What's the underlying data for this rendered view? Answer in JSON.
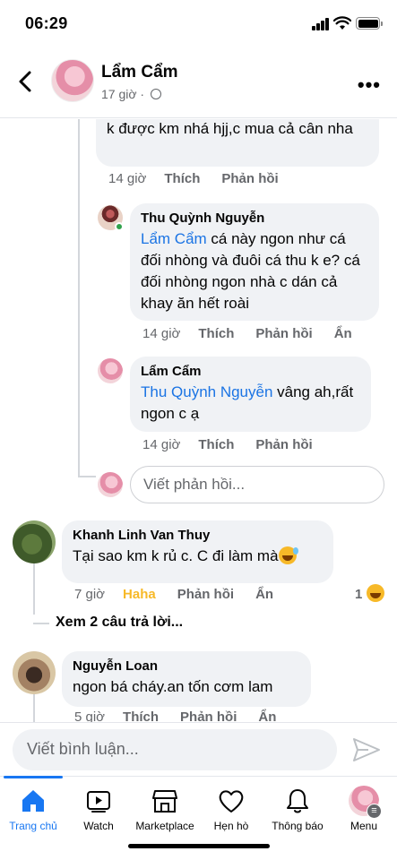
{
  "status": {
    "time": "06:29"
  },
  "header": {
    "title": "Lẩm Cẩm",
    "subtitle": "17 giờ"
  },
  "comments": {
    "top_reply": {
      "text": "k được km nhá hjj,c mua cả cân nha",
      "time": "14 giờ",
      "like": "Thích",
      "reply": "Phản hồi"
    },
    "thu": {
      "name": "Thu Quỳnh Nguyễn",
      "mention": "Lẩm Cẩm",
      "text": " cá này ngon như cá đối nhòng và đuôi cá thu k e? cá đối nhòng ngon nhà c dán cả khay ăn hết roài",
      "time": "14 giờ",
      "like": "Thích",
      "reply": "Phản hồi",
      "hide": "Ẩn"
    },
    "lam": {
      "name": "Lẩm Cẩm",
      "mention": "Thu Quỳnh Nguyễn",
      "text": " vâng ah,rất ngon c ạ",
      "time": "14 giờ",
      "like": "Thích",
      "reply": "Phản hồi"
    },
    "reply_placeholder": "Viết phản hồi...",
    "khanh": {
      "name": "Khanh Linh Van Thuy",
      "text": "Tại sao km k rủ c. C đi làm mà",
      "time": "7 giờ",
      "reaction": "Haha",
      "reply": "Phản hồi",
      "hide": "Ẩn",
      "reaction_count": "1"
    },
    "see_more": "Xem 2 câu trả lời...",
    "loan": {
      "name": "Nguyễn Loan",
      "text": "ngon bá cháy.an tốn cơm lam",
      "time": "5 giờ",
      "like": "Thích",
      "reply": "Phản hồi",
      "hide": "Ẩn"
    }
  },
  "composer": {
    "placeholder": "Viết bình luận..."
  },
  "tabs": [
    {
      "label": "Trang chủ",
      "icon": "home-icon"
    },
    {
      "label": "Watch",
      "icon": "watch-icon"
    },
    {
      "label": "Marketplace",
      "icon": "marketplace-icon"
    },
    {
      "label": "Hẹn hò",
      "icon": "dating-icon"
    },
    {
      "label": "Thông báo",
      "icon": "bell-icon"
    },
    {
      "label": "Menu",
      "icon": "menu-avatar"
    }
  ],
  "colors": {
    "accent": "#1877f2",
    "mention": "#1b74e4",
    "haha": "#f7b928",
    "bubble": "#f0f2f5",
    "online": "#31a24c"
  }
}
